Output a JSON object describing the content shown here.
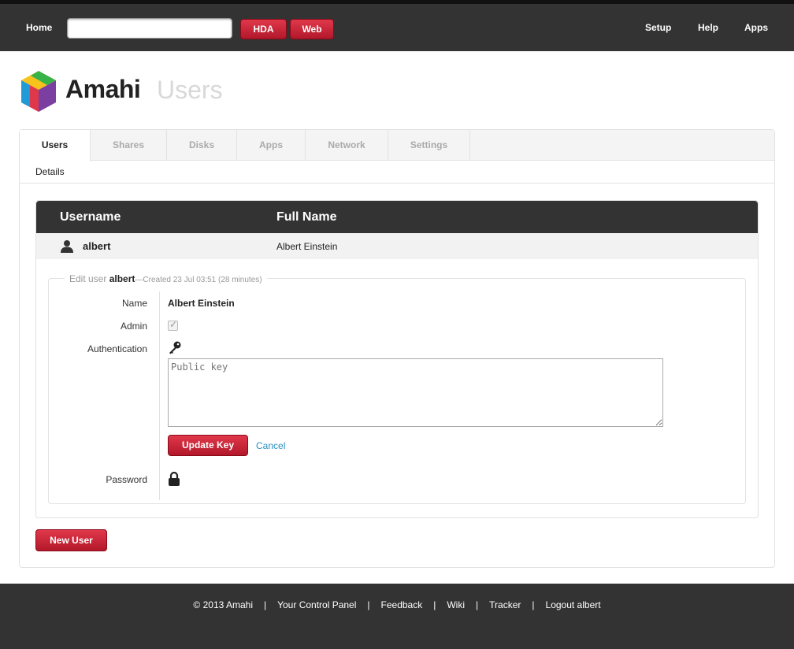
{
  "topbar": {
    "home": "Home",
    "search_value": "",
    "hda_button": "HDA",
    "web_button": "Web",
    "setup": "Setup",
    "help": "Help",
    "apps": "Apps"
  },
  "brand": {
    "name": "Amahi",
    "page_title": "Users"
  },
  "tabs": [
    {
      "label": "Users",
      "active": true
    },
    {
      "label": "Shares"
    },
    {
      "label": "Disks"
    },
    {
      "label": "Apps"
    },
    {
      "label": "Network"
    },
    {
      "label": "Settings"
    }
  ],
  "subnav": {
    "details": "Details"
  },
  "table": {
    "headers": {
      "username": "Username",
      "fullname": "Full Name"
    },
    "rows": [
      {
        "username": "albert",
        "fullname": "Albert Einstein"
      }
    ]
  },
  "edit": {
    "legend_prefix": "Edit user",
    "legend_user": "albert",
    "legend_created": "—Created 23 Jul 03:51 (28 minutes)",
    "name_label": "Name",
    "name_value": "Albert Einstein",
    "admin_label": "Admin",
    "admin_checked": true,
    "auth_label": "Authentication",
    "public_key_placeholder": "Public key",
    "update_key_button": "Update Key",
    "cancel_link": "Cancel",
    "password_label": "Password"
  },
  "new_user_button": "New User",
  "footer": {
    "copyright": "© 2013 Amahi",
    "control_panel": "Your Control Panel",
    "feedback": "Feedback",
    "wiki": "Wiki",
    "tracker": "Tracker",
    "logout": "Logout albert",
    "separator": "|"
  },
  "colors": {
    "topbar_bg": "#333333",
    "accent_red": "#c8223a",
    "link_blue": "#2a8fc1"
  }
}
